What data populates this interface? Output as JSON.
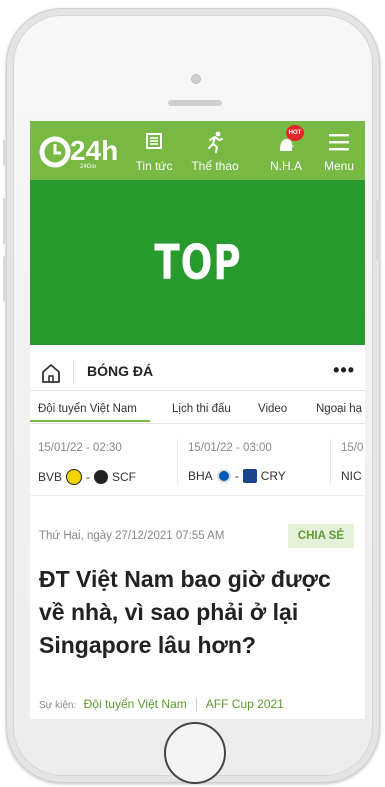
{
  "header": {
    "logo_text": "24h",
    "logo_subtext": "24Gio",
    "nav": [
      {
        "label": "Tin tức",
        "icon": "news-icon"
      },
      {
        "label": "Thể thao",
        "icon": "runner-icon"
      },
      {
        "label": "N.H.A",
        "icon": "nha-icon",
        "badge": "HOT"
      },
      {
        "label": "Menu",
        "icon": "hamburger-icon"
      }
    ]
  },
  "banner": {
    "text": "TOP"
  },
  "category": {
    "title": "BÓNG ĐÁ",
    "more": "•••"
  },
  "subnav": [
    "Đội tuyển Việt Nam",
    "Lịch thi đấu",
    "Video",
    "Ngoại hạ"
  ],
  "matches": [
    {
      "time": "15/01/22 - 02:30",
      "home": "BVB",
      "sep": "-",
      "away": "SCF"
    },
    {
      "time": "15/01/22 - 03:00",
      "home": "BHA",
      "sep": "-",
      "away": "CRY"
    },
    {
      "time": "15/0",
      "home": "NIC",
      "sep": "",
      "away": ""
    }
  ],
  "article": {
    "date": "Thứ Hai, ngày 27/12/2021 07:55 AM",
    "share_label": "CHIA SẺ",
    "title": "ĐT Việt Nam bao giờ được về nhà, vì sao phải ở lại Singapore lâu hơn?",
    "event_label": "Sự kiện:",
    "tags": [
      "Đội tuyển Việt Nam",
      "AFF Cup 2021"
    ]
  },
  "colors": {
    "header_green": "#78b943",
    "banner_green": "#289a2e",
    "tag_green": "#5b9a2f",
    "share_bg": "#e6f1d9"
  }
}
